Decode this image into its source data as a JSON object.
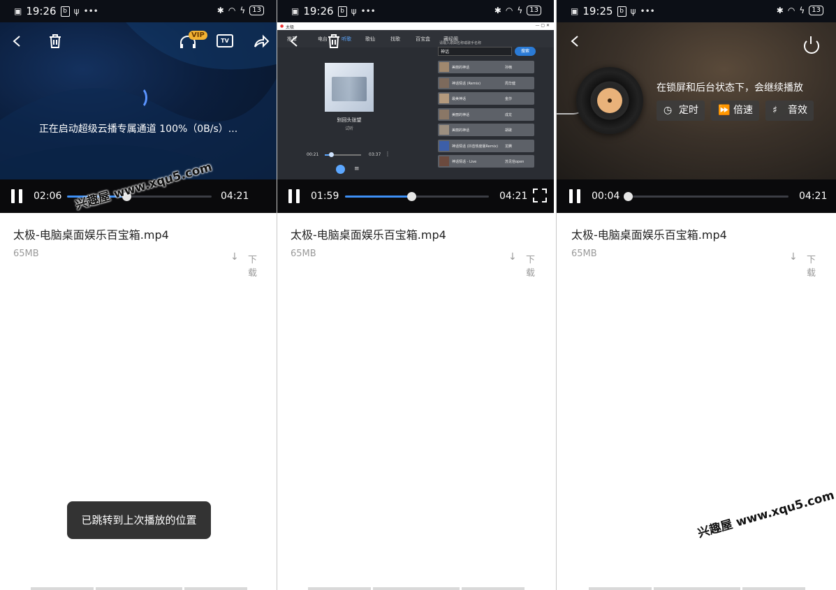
{
  "status": {
    "p1_time": "19:26",
    "p2_time": "19:26",
    "p3_time": "19:25",
    "battery": "13"
  },
  "file": {
    "title": "太极-电脑桌面娱乐百宝箱.mp4",
    "size": "65MB",
    "download_label": "下载"
  },
  "panel1": {
    "loading_text": "正在启动超级云播专属通道 100%（0B/s）...",
    "vip_badge": "VIP",
    "tv_label": "TV",
    "time_current": "02:06",
    "time_total": "04:21",
    "progress": 0.41,
    "toast": "已跳转到上次播放的位置"
  },
  "panel2": {
    "time_current": "01:59",
    "time_total": "04:21",
    "progress": 0.46,
    "desktop": {
      "window_title": "太极",
      "nav": [
        "推荐",
        "电台",
        "听歌",
        "歌仙",
        "找歌",
        "百宝盒",
        "藏经阁"
      ],
      "search_hint": "请输入歌曲名称或歌手名称",
      "search_value": "神话",
      "search_button": "搜索",
      "song_title": "别回头张望",
      "song_singer": "试听",
      "mini_time_current": "00:21",
      "mini_time_total": "03:37",
      "results": [
        {
          "name": "美丽的神话",
          "artist": "孙楠"
        },
        {
          "name": "神话情话 (Remix)",
          "artist": "周华健"
        },
        {
          "name": "最美神话",
          "artist": "金莎"
        },
        {
          "name": "美丽的神话",
          "artist": "成龙"
        },
        {
          "name": "美丽的神话",
          "artist": "胡歌"
        },
        {
          "name": "神话情话 (抖音热度版Remix)",
          "artist": "龙腾"
        },
        {
          "name": "神话情话 - Live",
          "artist": "苏见信open"
        }
      ]
    }
  },
  "panel3": {
    "message": "在锁屏和后台状态下，会继续播放",
    "btn_timer": "定时",
    "btn_speed": "倍速",
    "btn_effect": "音效",
    "time_current": "00:04",
    "time_total": "04:21",
    "progress": 0.0
  },
  "watermark": "兴趣屋 www.xqu5.com",
  "colors": {
    "accent": "#3d8ff5",
    "vip": "#f2b233",
    "toast_bg": "#333333"
  }
}
